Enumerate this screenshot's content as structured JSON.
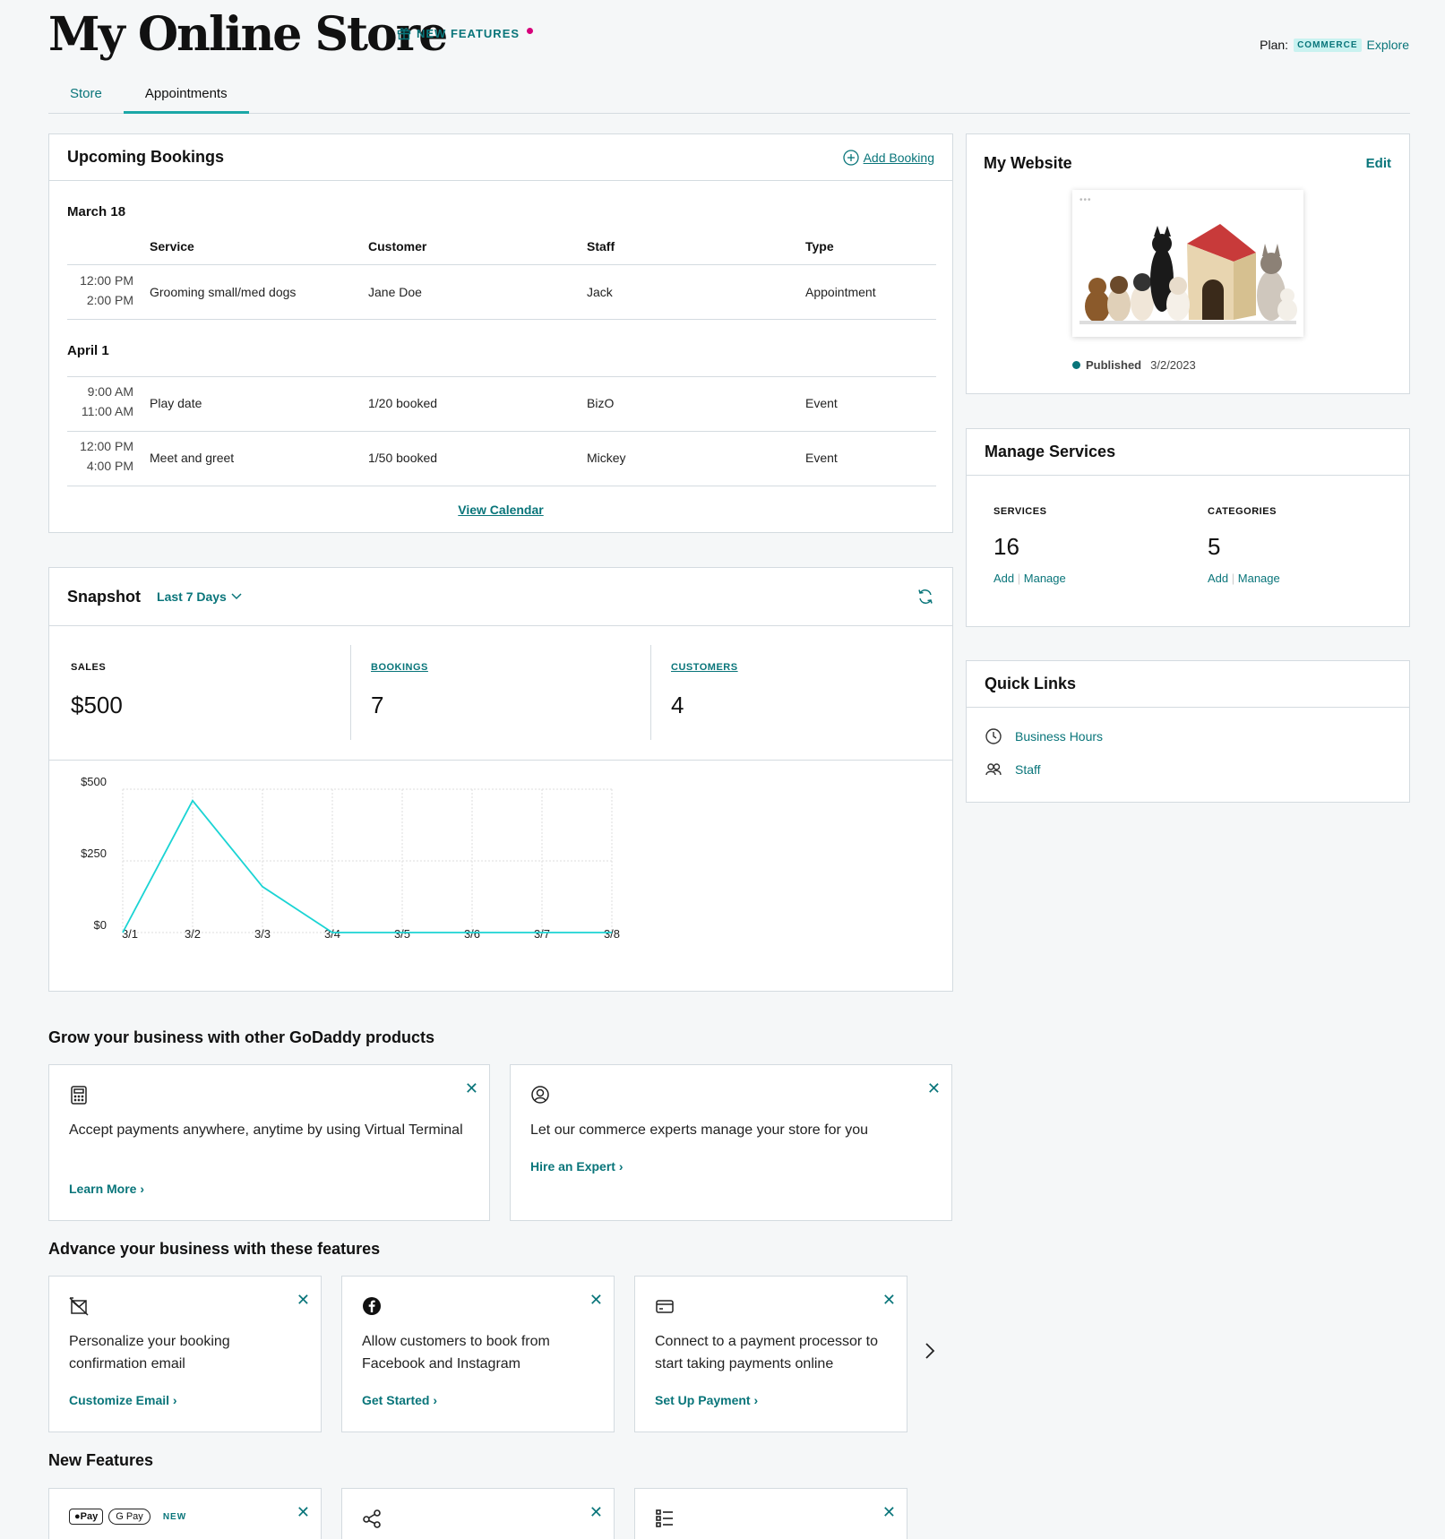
{
  "header": {
    "store_title": "My Online Store",
    "new_features_label": "NEW FEATURES",
    "plan_label": "Plan:",
    "plan_name": "COMMERCE",
    "explore_label": "Explore"
  },
  "tabs": [
    {
      "label": "Store",
      "active": false
    },
    {
      "label": "Appointments",
      "active": true
    }
  ],
  "bookings": {
    "title": "Upcoming Bookings",
    "add_label": "Add Booking",
    "columns": [
      "Service",
      "Customer",
      "Staff",
      "Type"
    ],
    "groups": [
      {
        "date": "March 18",
        "rows": [
          {
            "start": "12:00 PM",
            "end": "2:00 PM",
            "service": "Grooming small/med dogs",
            "customer": "Jane Doe",
            "staff": "Jack",
            "type": "Appointment"
          }
        ]
      },
      {
        "date": "April 1",
        "rows": [
          {
            "start": "9:00 AM",
            "end": "11:00 AM",
            "service": "Play date",
            "customer": "1/20 booked",
            "staff": "BizO",
            "type": "Event"
          },
          {
            "start": "12:00 PM",
            "end": "4:00 PM",
            "service": "Meet and greet",
            "customer": "1/50 booked",
            "staff": "Mickey",
            "type": "Event"
          }
        ]
      }
    ],
    "view_calendar_label": "View Calendar"
  },
  "snapshot": {
    "title": "Snapshot",
    "range_label": "Last 7 Days",
    "stats": [
      {
        "label": "SALES",
        "value": "$500"
      },
      {
        "label": "BOOKINGS",
        "value": "7"
      },
      {
        "label": "CUSTOMERS",
        "value": "4"
      }
    ]
  },
  "chart_data": {
    "type": "line",
    "x": [
      "3/1",
      "3/2",
      "3/3",
      "3/4",
      "3/5",
      "3/6",
      "3/7",
      "3/8"
    ],
    "values": [
      0,
      460,
      160,
      0,
      0,
      0,
      0,
      0
    ],
    "yticks": [
      "$500",
      "$250",
      "$0"
    ],
    "ylim": [
      0,
      500
    ],
    "grid": true,
    "color": "#1bd4d4"
  },
  "website": {
    "title": "My Website",
    "edit_label": "Edit",
    "published_label": "Published",
    "published_date": "3/2/2023"
  },
  "services": {
    "title": "Manage Services",
    "items": [
      {
        "label": "SERVICES",
        "value": "16",
        "add": "Add",
        "manage": "Manage"
      },
      {
        "label": "CATEGORIES",
        "value": "5",
        "add": "Add",
        "manage": "Manage"
      }
    ]
  },
  "quick_links": {
    "title": "Quick Links",
    "items": [
      {
        "label": "Business Hours",
        "icon": "clock-icon"
      },
      {
        "label": "Staff",
        "icon": "people-icon"
      }
    ]
  },
  "grow": {
    "title": "Grow your business with other GoDaddy products",
    "cards": [
      {
        "text": "Accept payments anywhere, anytime by using Virtual Terminal",
        "link": "Learn More ›",
        "icon": "calculator-icon"
      },
      {
        "text": "Let our commerce experts manage your store for you",
        "link": "Hire an Expert ›",
        "icon": "user-circle-icon"
      }
    ]
  },
  "advance": {
    "title": "Advance your business with these features",
    "cards": [
      {
        "text": "Personalize your booking confirmation email",
        "link": "Customize Email ›",
        "icon": "email-off-icon"
      },
      {
        "text": "Allow customers to book from Facebook and Instagram",
        "link": "Get Started ›",
        "icon": "facebook-icon"
      },
      {
        "text": "Connect to a payment processor to start taking payments online",
        "link": "Set Up Payment ›",
        "icon": "card-icon"
      }
    ]
  },
  "new_features": {
    "title": "New Features",
    "apple_pay": "Pay",
    "google_pay": "G Pay",
    "new_badge": "NEW"
  }
}
